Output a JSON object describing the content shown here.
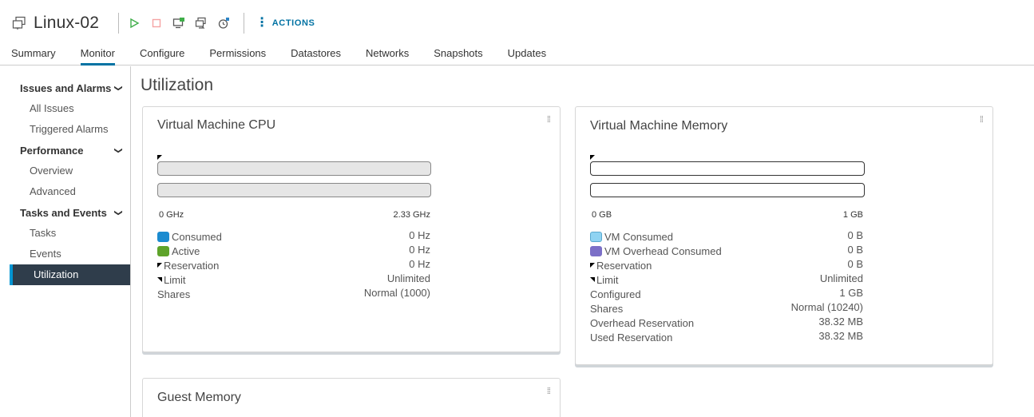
{
  "header": {
    "vm_name": "Linux-02",
    "actions_label": "ACTIONS",
    "icons": [
      "vm-icon",
      "power-on-icon",
      "power-off-icon",
      "launch-console-icon",
      "migrate-icon",
      "snapshot-icon"
    ]
  },
  "tabs": [
    {
      "label": "Summary",
      "active": false
    },
    {
      "label": "Monitor",
      "active": true
    },
    {
      "label": "Configure",
      "active": false
    },
    {
      "label": "Permissions",
      "active": false
    },
    {
      "label": "Datastores",
      "active": false
    },
    {
      "label": "Networks",
      "active": false
    },
    {
      "label": "Snapshots",
      "active": false
    },
    {
      "label": "Updates",
      "active": false
    }
  ],
  "sidebar": {
    "groups": [
      {
        "label": "Issues and Alarms",
        "items": [
          "All Issues",
          "Triggered Alarms"
        ]
      },
      {
        "label": "Performance",
        "items": [
          "Overview",
          "Advanced"
        ]
      },
      {
        "label": "Tasks and Events",
        "items": [
          "Tasks",
          "Events"
        ]
      }
    ],
    "active_item": "Utilization"
  },
  "main": {
    "title": "Utilization",
    "cpu_card": {
      "title": "Virtual Machine CPU",
      "axis_min": "0 GHz",
      "axis_max": "2.33 GHz",
      "rows": [
        {
          "label": "Consumed",
          "value": "0 Hz"
        },
        {
          "label": "Active",
          "value": "0 Hz"
        },
        {
          "label": "Reservation",
          "value": "0 Hz"
        },
        {
          "label": "Limit",
          "value": "Unlimited"
        },
        {
          "label": "Shares",
          "value": "Normal (1000)"
        }
      ]
    },
    "memory_card": {
      "title": "Virtual Machine Memory",
      "axis_min": "0 GB",
      "axis_max": "1 GB",
      "rows": [
        {
          "label": "VM Consumed",
          "value": "0 B"
        },
        {
          "label": "VM Overhead Consumed",
          "value": "0 B"
        },
        {
          "label": "Reservation",
          "value": "0 B"
        },
        {
          "label": "Limit",
          "value": "Unlimited"
        },
        {
          "label": "Configured",
          "value": "1 GB"
        },
        {
          "label": "Shares",
          "value": "Normal (10240)"
        },
        {
          "label": "Overhead Reservation",
          "value": "38.32 MB"
        },
        {
          "label": "Used Reservation",
          "value": "38.32 MB"
        }
      ]
    },
    "guest_card": {
      "title": "Guest Memory"
    }
  },
  "colors": {
    "accent": "#0072a3",
    "cpu_consumed": "#1b8bd0",
    "cpu_active": "#5ea32a",
    "mem_consumed": "#8fd3f2",
    "mem_overhead": "#7b6fc7",
    "sidebar_active_bg": "#2f3d4b",
    "power_on": "#3fae49",
    "power_off": "#f5a4a4"
  }
}
